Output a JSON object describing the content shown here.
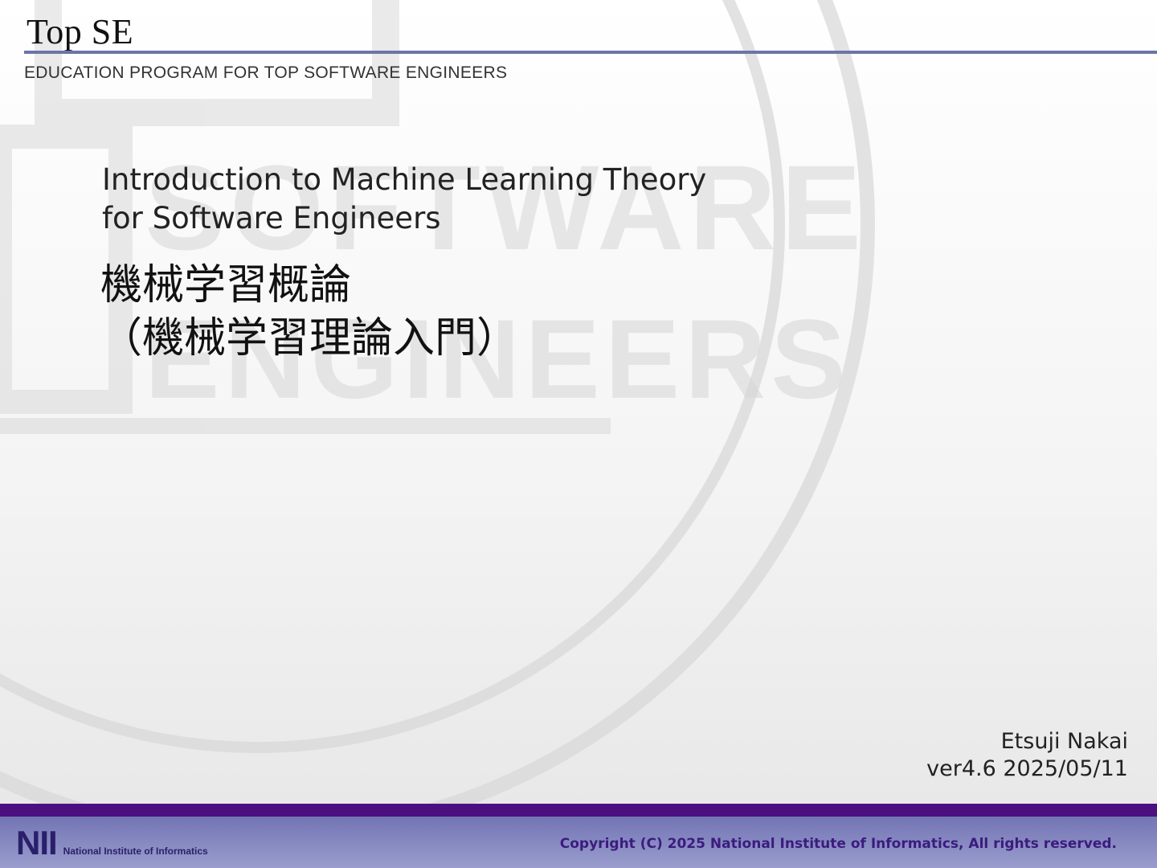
{
  "header": {
    "brand": "Top SE",
    "subtitle": "EDUCATION PROGRAM FOR TOP SOFTWARE ENGINEERS"
  },
  "title": {
    "english_line1": "Introduction to Machine Learning Theory",
    "english_line2": "for Software Engineers",
    "japanese_line1": "機械学習概論",
    "japanese_line2": "（機械学習理論入門）"
  },
  "author": {
    "name": "Etsuji Nakai",
    "version": "ver4.6 2025/05/11"
  },
  "footer": {
    "logo_mark": "NII",
    "logo_text": "National Institute of Informatics",
    "copyright": "Copyright (C) 2025 National Institute of Informatics, All rights reserved."
  },
  "colors": {
    "rule": "#6b75a8",
    "footer_bar": "#4b0f82",
    "footer_bg": "#8588c2",
    "copyright_text": "#3c1b7e"
  }
}
